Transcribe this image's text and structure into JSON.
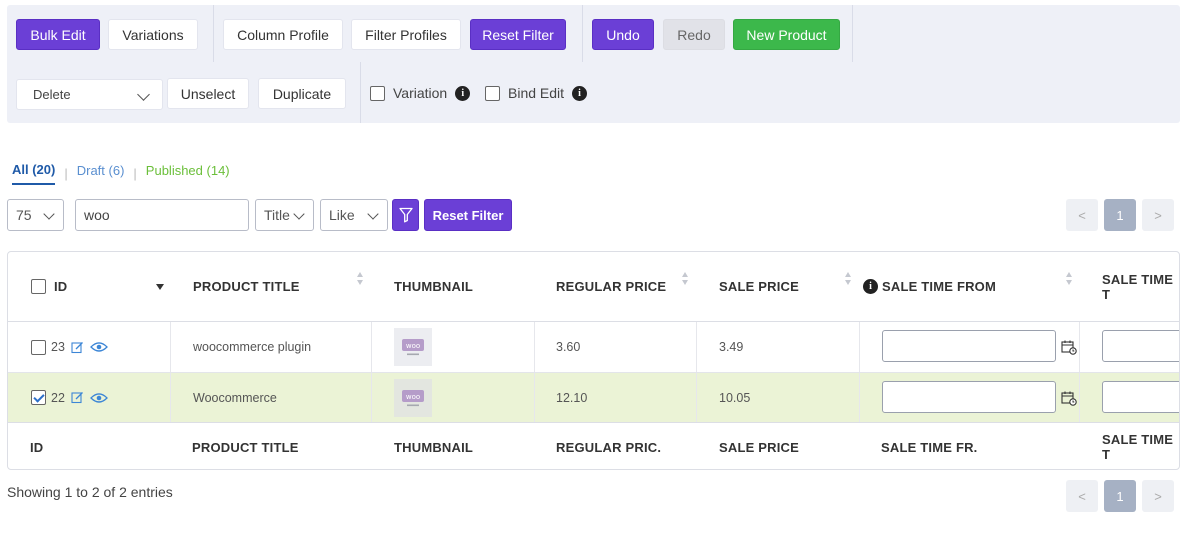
{
  "toolbar": {
    "bulk_edit": "Bulk Edit",
    "variations": "Variations",
    "column_profile": "Column Profile",
    "filter_profiles": "Filter Profiles",
    "reset_filter": "Reset Filter",
    "undo": "Undo",
    "redo": "Redo",
    "new_product": "New Product",
    "bulk_action_select": "Delete",
    "unselect": "Unselect",
    "duplicate": "Duplicate",
    "variation_label": "Variation",
    "bind_edit_label": "Bind Edit",
    "variation_checked": false,
    "bind_edit_checked": false
  },
  "status_tabs": [
    {
      "label": "All (20)",
      "active": true
    },
    {
      "label": "Draft (6)",
      "active": false
    },
    {
      "label": "Published (14)",
      "active": false
    }
  ],
  "filter": {
    "per_page": "75",
    "search_value": "woo",
    "field": "Title",
    "operator": "Like",
    "reset_label": "Reset Filter"
  },
  "pagination": {
    "prev": "<",
    "current": "1",
    "next": ">"
  },
  "table": {
    "headers": {
      "id": "ID",
      "product_title": "PRODUCT TITLE",
      "thumbnail": "THUMBNAIL",
      "regular_price": "REGULAR PRICE",
      "sale_price": "SALE PRICE",
      "sale_time_from": "SALE TIME FROM",
      "sale_time_to": "SALE TIME T"
    },
    "footer_headers": {
      "id": "ID",
      "product_title": "PRODUCT TITLE",
      "thumbnail": "THUMBNAIL",
      "regular_price": "REGULAR PRIC.",
      "sale_price": "SALE PRICE",
      "sale_time_from": "SALE TIME FR.",
      "sale_time_to": "SALE TIME T"
    },
    "rows": [
      {
        "id": "23",
        "title": "woocommerce plugin",
        "thumb_text": "woo",
        "regular_price": "3.60",
        "sale_price": "3.49",
        "selected": false
      },
      {
        "id": "22",
        "title": "Woocommerce",
        "thumb_text": "woo",
        "regular_price": "12.10",
        "sale_price": "10.05",
        "selected": true
      }
    ]
  },
  "footer": {
    "entries_text": "Showing 1 to 2 of 2 entries"
  },
  "colors": {
    "primary": "#6b3fd6",
    "success": "#3cb84b",
    "selected_row": "#ebf3d6",
    "link": "#1f5aa8"
  }
}
